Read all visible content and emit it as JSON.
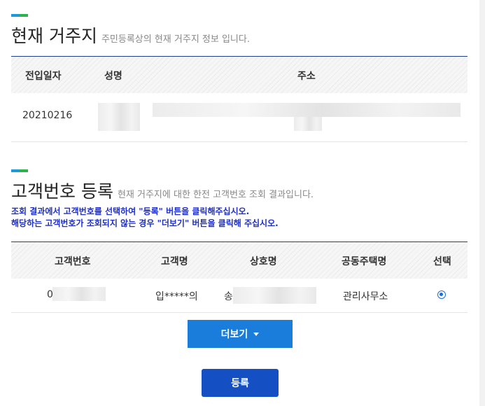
{
  "residence": {
    "title": "현재 거주지",
    "subtitle": "주민등록상의 현재 거주지 정보 입니다.",
    "headers": {
      "move_in_date": "전입일자",
      "name": "성명",
      "address": "주소"
    },
    "row": {
      "move_in_date": "20210216"
    }
  },
  "customer": {
    "title": "고객번호 등록",
    "subtitle": "현재 거주지에 대한 한전 고객번호 조회 결과입니다.",
    "notice_line1": "조회 결과에서 고객번호를 선택하여 \"등록\" 버튼을 클릭해주십시오.",
    "notice_line2": "해당하는 고객번호가 조회되지 않는 경우 \"더보기\" 버튼을 클릭해 주십시오.",
    "headers": {
      "number": "고객번호",
      "name": "고객명",
      "business": "상호명",
      "apartment": "공동주택명",
      "select": "선택"
    },
    "row": {
      "number_prefix": "0",
      "name": "입*****의",
      "business_prefix": "송",
      "apartment": "관리사무소",
      "selected": true
    }
  },
  "buttons": {
    "more_label": "더보기",
    "register_label": "등록"
  }
}
